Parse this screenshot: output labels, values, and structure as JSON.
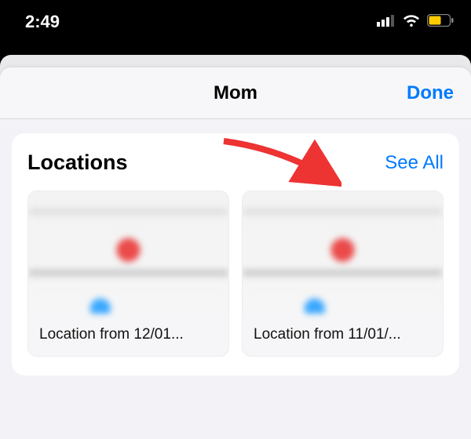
{
  "status": {
    "time": "2:49"
  },
  "nav": {
    "title": "Mom",
    "done": "Done"
  },
  "locations": {
    "title": "Locations",
    "see_all": "See All",
    "items": [
      {
        "label": "Location from 12/01..."
      },
      {
        "label": "Location from 11/01/..."
      }
    ]
  },
  "colors": {
    "accent": "#007aff"
  }
}
